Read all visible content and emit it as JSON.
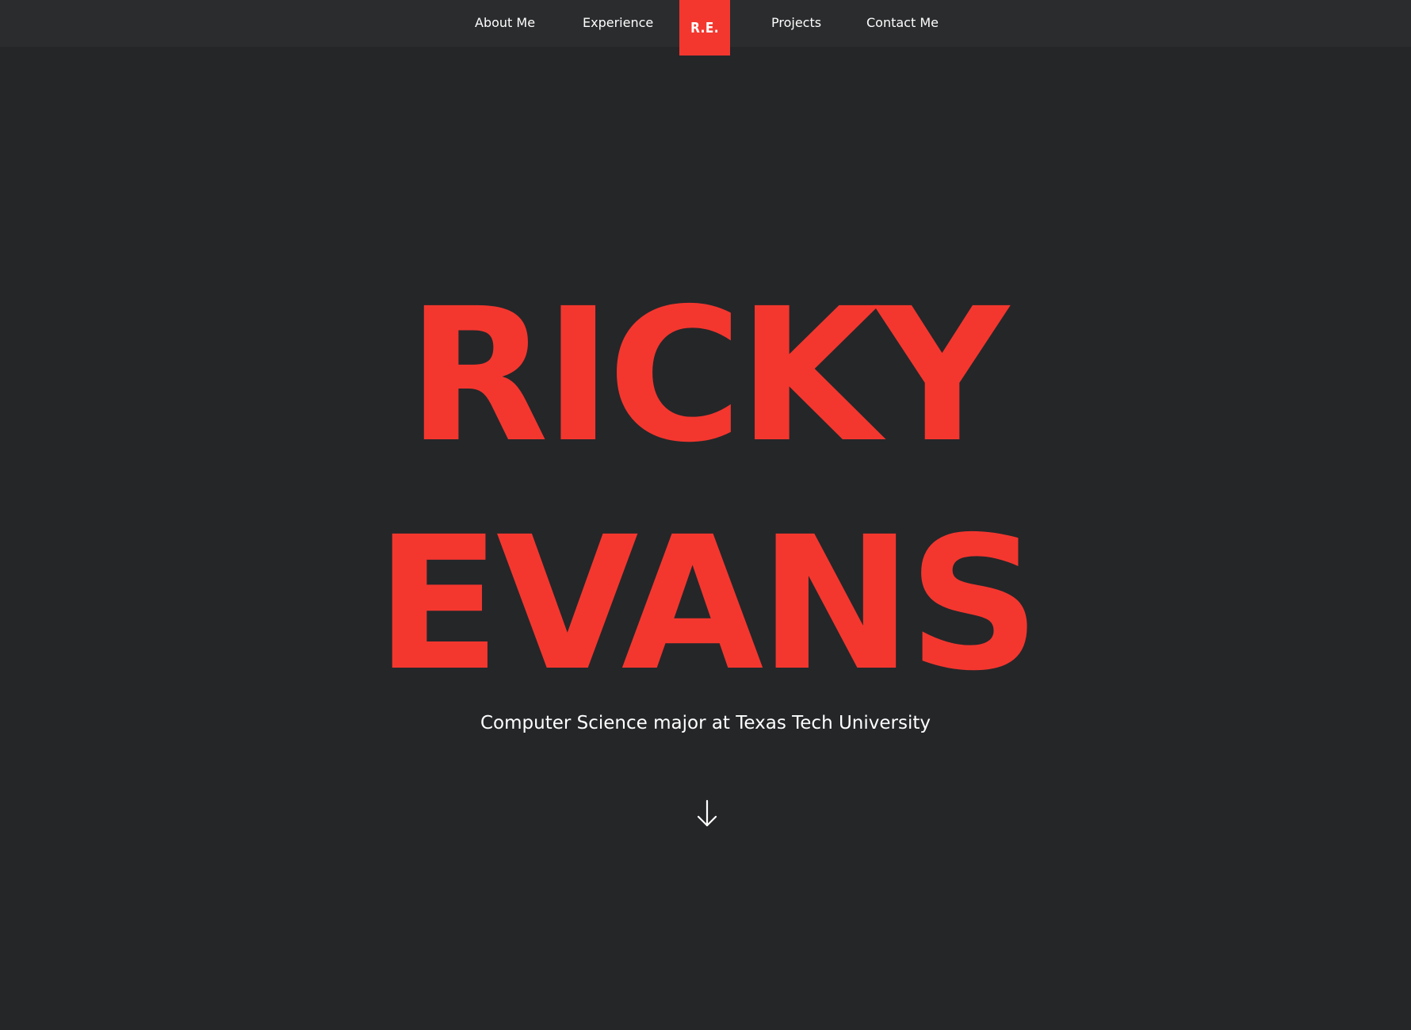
{
  "nav": {
    "links": [
      {
        "label": "About Me"
      },
      {
        "label": "Experience"
      },
      {
        "label": "Projects"
      },
      {
        "label": "Contact Me"
      }
    ],
    "logo_text": "R.E."
  },
  "hero": {
    "first_name": "RICKY",
    "last_name": "EVANS",
    "subtitle": "Computer Science major at Texas Tech University",
    "scroll_icon": "arrow-down-icon"
  },
  "colors": {
    "background": "#252628",
    "nav_background": "#2b2c2e",
    "accent": "#f3372f",
    "text": "#ffffff"
  }
}
